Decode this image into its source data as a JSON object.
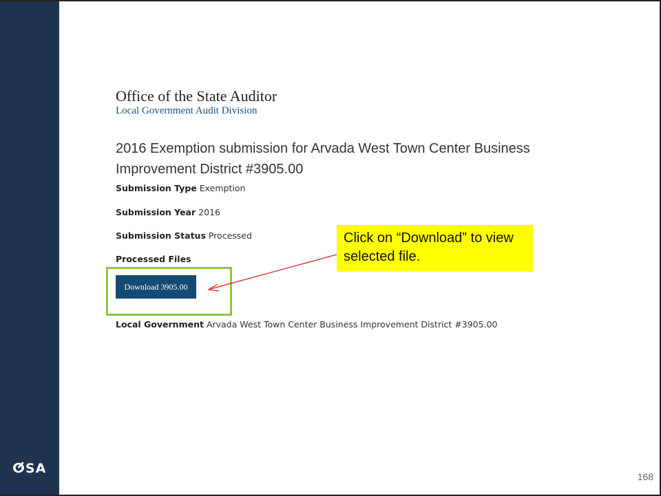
{
  "logo": {
    "text": "ⵚSA"
  },
  "office": {
    "title": "Office of the State Auditor",
    "subtitle": "Local Government Audit Division"
  },
  "submission": {
    "heading": "2016 Exemption submission for Arvada West Town Center Business Improvement District #3905.00",
    "type_label": "Submission Type",
    "type_value": "Exemption",
    "year_label": "Submission Year",
    "year_value": "2016",
    "status_label": "Submission Status",
    "status_value": "Processed",
    "files_label": "Processed Files",
    "download_label": "Download 3905.00",
    "local_gov_label": "Local Government",
    "local_gov_value": "Arvada West Town Center Business Improvement District #3905.00"
  },
  "callout": {
    "text": "Click on “Download” to view selected file."
  },
  "page_number": "168",
  "colors": {
    "sidebar": "#1f3350",
    "button": "#154a73",
    "highlight": "#8cc63f",
    "callout": "#ffff00",
    "arrow": "#e02020"
  }
}
